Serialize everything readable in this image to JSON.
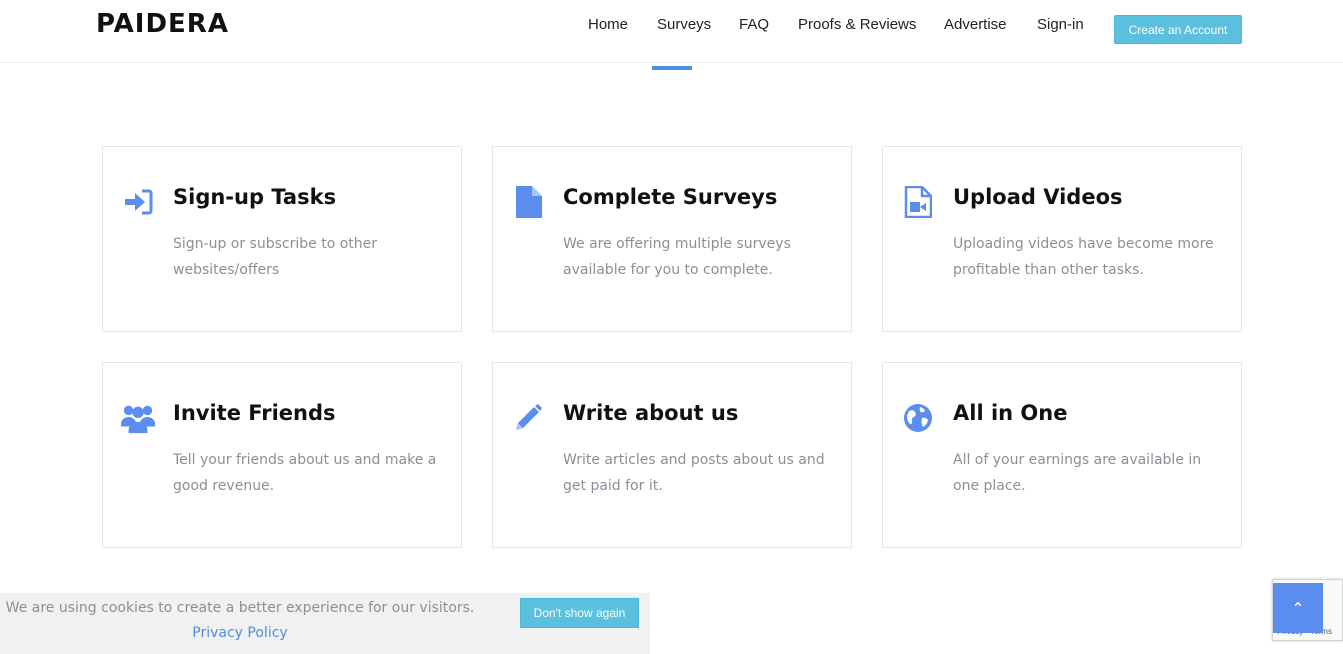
{
  "brand": {
    "logo": "PAIDERA"
  },
  "nav": {
    "items": [
      {
        "label": "Home"
      },
      {
        "label": "Surveys"
      },
      {
        "label": "FAQ"
      },
      {
        "label": "Proofs & Reviews"
      },
      {
        "label": "Advertise"
      },
      {
        "label": "Sign-in"
      }
    ],
    "cta_label": "Create an Account",
    "active_index": 1
  },
  "features": [
    {
      "icon": "sign-in-icon",
      "title": "Sign-up Tasks",
      "desc": "Sign-up or subscribe to other websites/offers"
    },
    {
      "icon": "file-icon",
      "title": "Complete Surveys",
      "desc": "We are offering multiple surveys available for you to complete."
    },
    {
      "icon": "video-file-icon",
      "title": "Upload Videos",
      "desc": "Uploading videos have become more profitable than other tasks."
    },
    {
      "icon": "users-icon",
      "title": "Invite Friends",
      "desc": "Tell your friends about us and make a good revenue."
    },
    {
      "icon": "pencil-icon",
      "title": "Write about us",
      "desc": "Write articles and posts about us and get paid for it."
    },
    {
      "icon": "globe-icon",
      "title": "All in One",
      "desc": "All of your earnings are available in one place."
    }
  ],
  "cookie": {
    "text": "We are using cookies to create a better experience for our visitors.",
    "link_label": "Privacy Policy",
    "button_label": "Don't show again"
  },
  "recaptcha": {
    "text": "Privacy - Terms"
  },
  "colors": {
    "accent": "#5b8def",
    "cta": "#5bc0de",
    "muted_text": "#8a8f98"
  }
}
